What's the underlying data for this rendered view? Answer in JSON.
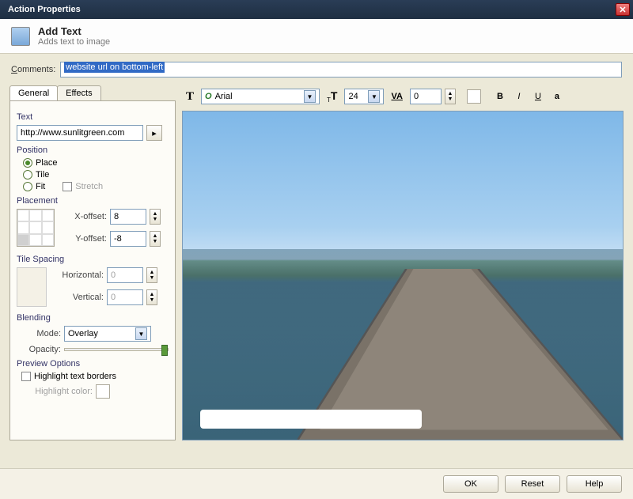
{
  "window": {
    "title": "Action Properties"
  },
  "header": {
    "title": "Add Text",
    "subtitle": "Adds text to image"
  },
  "comments": {
    "label": "Comments:",
    "value": "website url on bottom-left"
  },
  "tabs": {
    "general": "General",
    "effects": "Effects",
    "active": "general"
  },
  "text": {
    "section": "Text",
    "value": "http://www.sunlitgreen.com"
  },
  "position": {
    "section": "Position",
    "options": {
      "place": "Place",
      "tile": "Tile",
      "fit": "Fit"
    },
    "selected": "place",
    "stretch_label": "Stretch"
  },
  "placement": {
    "section": "Placement",
    "x_label": "X-offset:",
    "x_value": "8",
    "y_label": "Y-offset:",
    "y_value": "-8"
  },
  "tilespacing": {
    "section": "Tile Spacing",
    "h_label": "Horizontal:",
    "h_value": "0",
    "v_label": "Vertical:",
    "v_value": "0"
  },
  "blending": {
    "section": "Blending",
    "mode_label": "Mode:",
    "mode_value": "Overlay",
    "opacity_label": "Opacity:"
  },
  "preview_options": {
    "section": "Preview Options",
    "highlight_borders": "Highlight text borders",
    "highlight_color": "Highlight color:"
  },
  "toolbar": {
    "font": "Arial",
    "size": "24",
    "tracking": "0",
    "color": "#ffffff"
  },
  "buttons": {
    "ok": "OK",
    "reset": "Reset",
    "help": "Help"
  }
}
